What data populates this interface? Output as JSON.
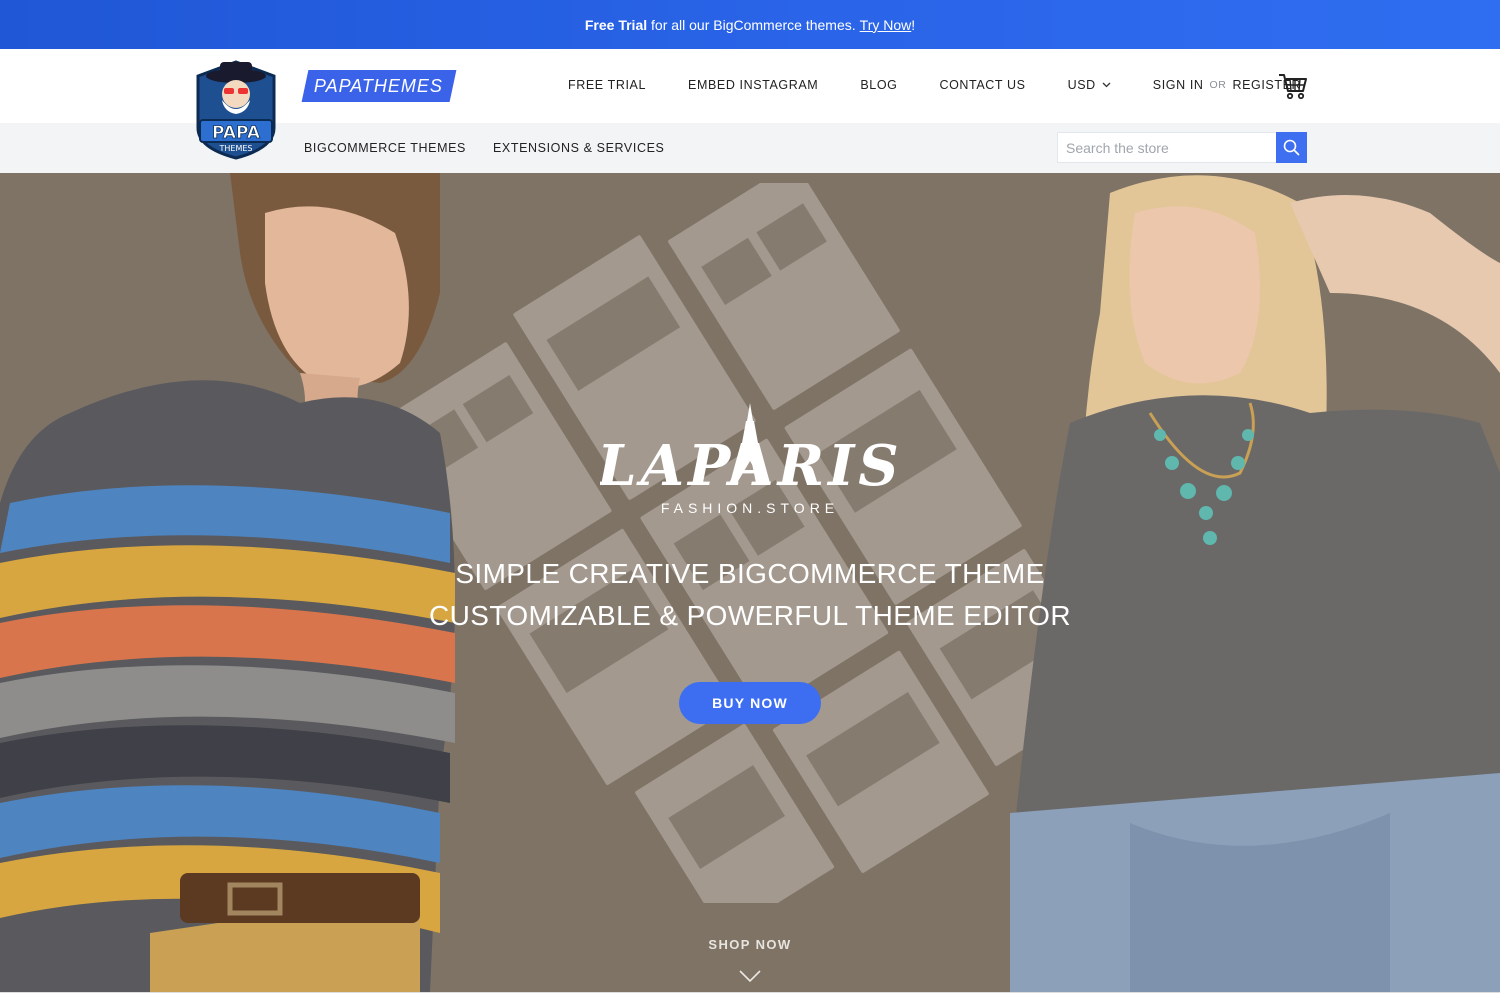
{
  "promo": {
    "bold": "Free Trial",
    "text": " for all our BigCommerce themes.",
    "link": "Try Now",
    "suffix": "!"
  },
  "header": {
    "logo_text": "PAPA",
    "logo_sub": "THEMES",
    "brand": "PAPATHEMES",
    "nav": {
      "free_trial": "FREE TRIAL",
      "embed_instagram": "EMBED INSTAGRAM",
      "blog": "BLOG",
      "contact_us": "CONTACT US",
      "currency": "USD",
      "sign_in": "SIGN IN",
      "or": "OR",
      "register": "REGISTER"
    }
  },
  "subnav": {
    "bigcommerce_themes": "BIGCOMMERCE THEMES",
    "extensions_services": "EXTENSIONS & SERVICES",
    "search_placeholder": "Search the store"
  },
  "hero": {
    "logo": "LAPARIS",
    "logo_sub": "FASHION.STORE",
    "line1": "SIMPLE CREATIVE BIGCOMMERCE THEME",
    "line2": "CUSTOMIZABLE & POWERFUL THEME EDITOR",
    "buy_now": "BUY NOW",
    "shop_now": "SHOP NOW"
  },
  "colors": {
    "accent": "#3d6ef2",
    "promo": "#2a64e8",
    "hero_bg": "#867a6d"
  }
}
